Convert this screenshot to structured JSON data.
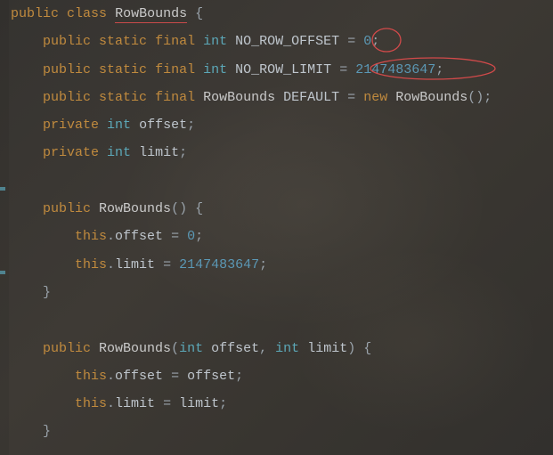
{
  "code": {
    "kw_public": "public",
    "kw_class": "class",
    "kw_static": "static",
    "kw_final": "final",
    "kw_private": "private",
    "kw_new": "new",
    "kw_this": "this",
    "typ_int": "int",
    "cls_RowBounds": "RowBounds",
    "id_NO_ROW_OFFSET": "NO_ROW_OFFSET",
    "id_NO_ROW_LIMIT": "NO_ROW_LIMIT",
    "id_DEFAULT": "DEFAULT",
    "id_offset": "offset",
    "id_limit": "limit",
    "num_0": "0",
    "num_intmax": "2147483647",
    "p_lbrace": "{",
    "p_rbrace": "}",
    "p_lparen": "(",
    "p_rparen": ")",
    "p_semi": ";",
    "p_comma": ",",
    "p_dot": ".",
    "p_eq": "=",
    "p_sp": " "
  },
  "annotations": {
    "underline_target": "RowBounds class name",
    "circle1_target": "literal 0 on NO_ROW_OFFSET line",
    "circle2_target": "literal 2147483647 on NO_ROW_LIMIT line"
  }
}
